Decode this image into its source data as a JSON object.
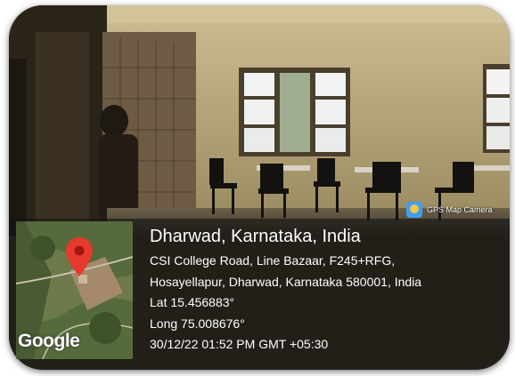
{
  "badge": {
    "label": "GPS Map Camera",
    "icon": "gps-camera-app-icon"
  },
  "map": {
    "logo_text": "Google",
    "pin_color": "#e8392f"
  },
  "location": {
    "place": "Dharwad, Karnataka, India",
    "address_line1": "CSI College Road, Line Bazaar, F245+RFG,",
    "address_line2": "Hosayellapur, Dharwad, Karnataka 580001, India",
    "lat": "Lat 15.456883°",
    "long": "Long 75.008676°",
    "datetime": "30/12/22 01:52 PM GMT +05:30"
  }
}
